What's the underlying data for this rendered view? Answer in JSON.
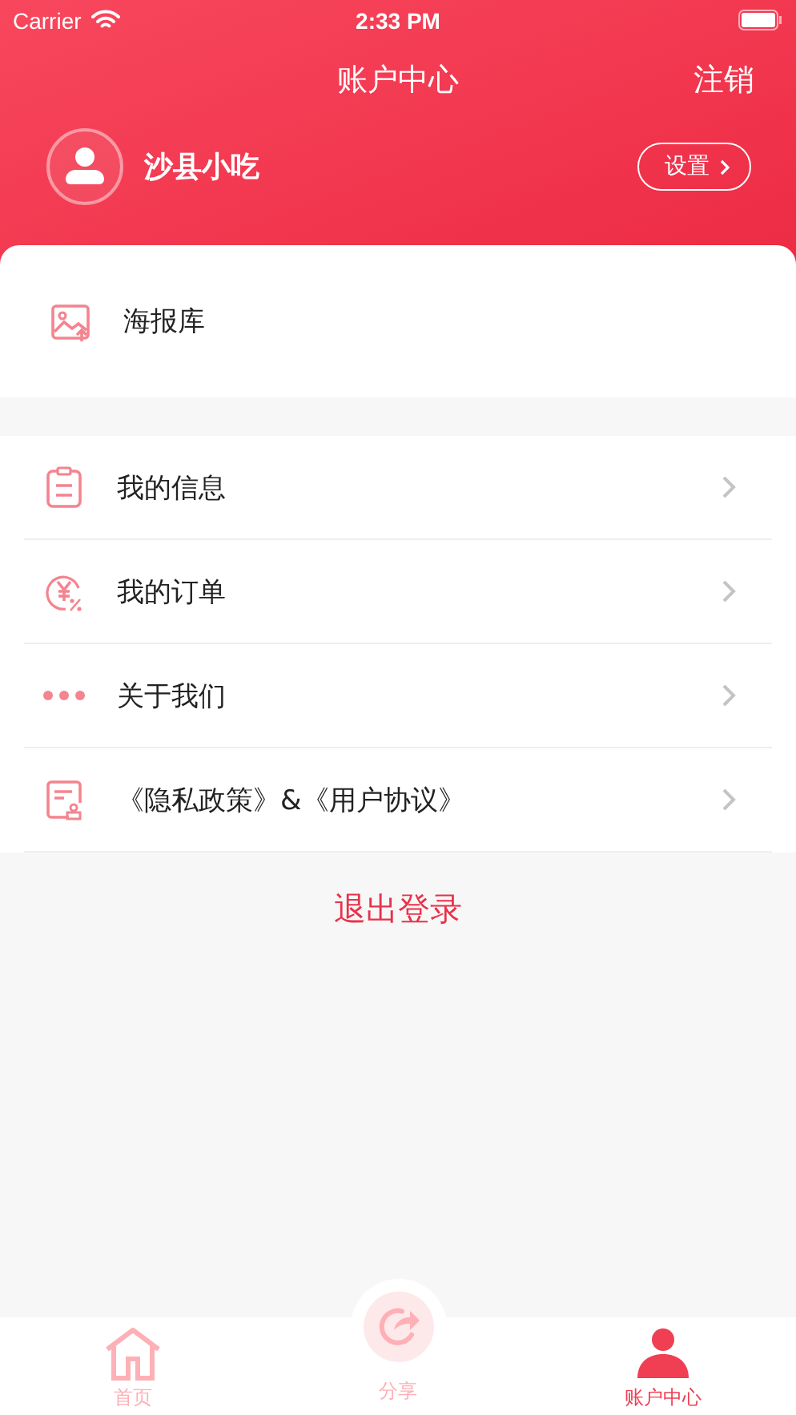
{
  "status_bar": {
    "carrier": "Carrier",
    "time": "2:33 PM"
  },
  "nav": {
    "title": "账户中心",
    "action": "注销"
  },
  "profile": {
    "name": "沙县小吃",
    "settings": "设置"
  },
  "poster": {
    "label": "海报库",
    "kind": "image"
  },
  "menu": [
    {
      "label": "我的信息",
      "kind": "clipboard"
    },
    {
      "label": "我的订单",
      "kind": "yen"
    },
    {
      "label": "关于我们",
      "kind": "dots"
    },
    {
      "label": "《隐私政策》&《用户协议》",
      "kind": "document"
    }
  ],
  "logout": "退出登录",
  "tabs": [
    {
      "label": "首页",
      "kind": "home",
      "selected": false
    },
    {
      "label": "分享",
      "kind": "share",
      "selected": false
    },
    {
      "label": "账户中心",
      "kind": "user",
      "selected": true
    }
  ]
}
